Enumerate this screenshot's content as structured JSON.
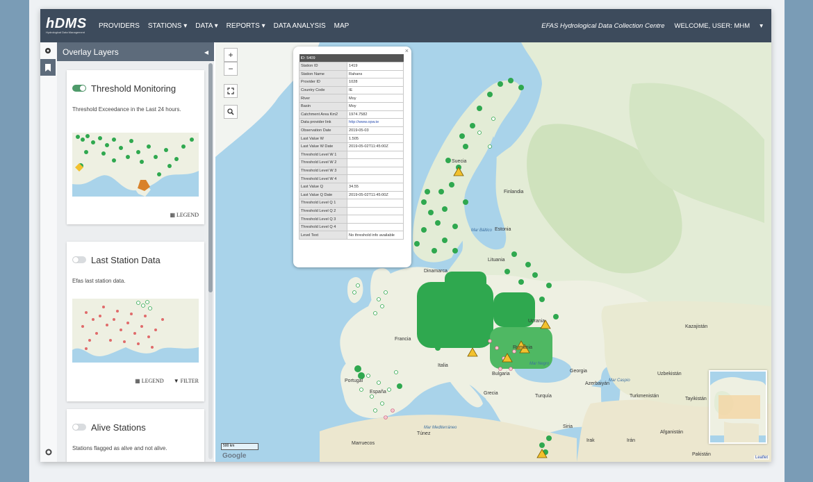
{
  "navbar": {
    "brand_title": "hDMS",
    "brand_subtitle": "Hydrological Data Management",
    "items": [
      "PROVIDERS",
      "STATIONS ▾",
      "DATA ▾",
      "REPORTS ▾",
      "DATA ANALYSIS",
      "MAP"
    ],
    "centre_name": "EFAS Hydrological Data Collection Centre",
    "welcome": "WELCOME, USER: MHM",
    "user_menu_caret": "▾"
  },
  "sidebar": {
    "title": "Overlay Layers",
    "collapse_icon": "◂",
    "layers": [
      {
        "title": "Threshold Monitoring",
        "enabled": true,
        "description": "Threshold Exceedance in the Last 24 hours.",
        "actions": [
          "▦ LEGEND"
        ]
      },
      {
        "title": "Last Station Data",
        "enabled": false,
        "description": "Efas last station data.",
        "actions": [
          "▦ LEGEND",
          "▼ FILTER"
        ]
      },
      {
        "title": "Alive Stations",
        "enabled": false,
        "description": "Stations flagged as alive and not alive.",
        "actions": []
      }
    ]
  },
  "map": {
    "controls": {
      "zoom_in": "+",
      "zoom_out": "−",
      "fullscreen": "⛶",
      "search": "🔍"
    },
    "popup": {
      "header": "ID: 5409",
      "close": "×",
      "rows": [
        [
          "Station ID",
          "1419"
        ],
        [
          "Station Name",
          "Rahans"
        ],
        [
          "Provider ID",
          "1028"
        ],
        [
          "Country Code",
          "IE"
        ],
        [
          "River",
          "Moy"
        ],
        [
          "Basin",
          "Moy"
        ],
        [
          "Catchment Area Km2",
          "1974.7582"
        ],
        [
          "Data provider link",
          "http://www.opw.ie"
        ],
        [
          "Observation Date",
          "2019-05-03"
        ],
        [
          "Last Value W",
          "1.505"
        ],
        [
          "Last Value W Date",
          "2019-05-02T11:45:00Z"
        ],
        [
          "Threshold Level W 1",
          ""
        ],
        [
          "Threshold Level W 2",
          ""
        ],
        [
          "Threshold Level W 3",
          ""
        ],
        [
          "Threshold Level W 4",
          ""
        ],
        [
          "Last Value Q",
          "34.55"
        ],
        [
          "Last Value Q Date",
          "2019-05-02T11:45:00Z"
        ],
        [
          "Threshold Level Q 1",
          ""
        ],
        [
          "Threshold Level Q 2",
          ""
        ],
        [
          "Threshold Level Q 3",
          ""
        ],
        [
          "Threshold Level Q 4",
          ""
        ],
        [
          "Level Text",
          "No threshold info available"
        ]
      ]
    },
    "country_labels": [
      "Suecia",
      "Finlandia",
      "Estonia",
      "Lituania",
      "Dinamarca",
      "Francia",
      "Italia",
      "España",
      "Portugal",
      "Grecia",
      "Turquía",
      "Ucrania",
      "Rumania",
      "Bulgaria",
      "Kazajistán",
      "Georgia",
      "Azerbaiyán",
      "Turkmenistán",
      "Uzbekistán",
      "Tayikistán",
      "Afganistán",
      "Irán",
      "Irak",
      "Siria",
      "Pakistán",
      "Marruecos",
      "Túnez"
    ],
    "sea_labels": [
      "Mar Negro",
      "Mar Báltico",
      "Mar Mediterráneo",
      "Mar Caspio"
    ],
    "scale_text": "500 km",
    "google_logo": "Google",
    "attribution": "Leaflet"
  },
  "colors": {
    "navbar": "#3d4b5c",
    "panel_header": "#5d6b7b",
    "station_green": "#2fa84f",
    "warning_yellow": "#f2c12e",
    "water": "#a9d3ea",
    "land": "#eef0e2"
  }
}
